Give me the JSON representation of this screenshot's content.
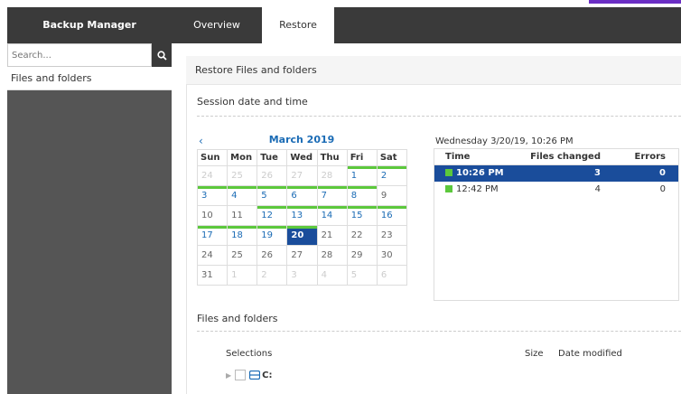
{
  "colors": {
    "accent": "#1a4d9b",
    "link": "#1a6bb5",
    "available": "#5cc83c",
    "dark": "#3a3a3a",
    "sidebar": "#555555"
  },
  "app": {
    "title": "Backup Manager"
  },
  "tabs": [
    {
      "label": "Overview"
    },
    {
      "label": "Restore"
    }
  ],
  "sidebar": {
    "search_placeholder": "Search...",
    "search_icon": "search-icon",
    "items": [
      {
        "label": "Files and folders"
      }
    ]
  },
  "main": {
    "panel_title": "Restore Files and folders",
    "session_section": "Session date and time",
    "files_section": "Files and folders"
  },
  "calendar": {
    "nav_prev": "‹",
    "month": "March 2019",
    "weekdays": [
      "Sun",
      "Mon",
      "Tue",
      "Wed",
      "Thu",
      "Fri",
      "Sat"
    ],
    "weeks": [
      [
        "24",
        "25",
        "26",
        "27",
        "28",
        "1",
        "2"
      ],
      [
        "3",
        "4",
        "5",
        "6",
        "7",
        "8",
        "9"
      ],
      [
        "10",
        "11",
        "12",
        "13",
        "14",
        "15",
        "16"
      ],
      [
        "17",
        "18",
        "19",
        "20",
        "21",
        "22",
        "23"
      ],
      [
        "24",
        "25",
        "26",
        "27",
        "28",
        "29",
        "30"
      ],
      [
        "31",
        "1",
        "2",
        "3",
        "4",
        "5",
        "6"
      ]
    ],
    "selected": "20"
  },
  "sessions": {
    "date_label": "Wednesday 3/20/19, 10:26 PM",
    "headers": [
      "Time",
      "Files changed",
      "Errors"
    ],
    "rows": [
      {
        "time": "10:26 PM",
        "files": "3",
        "errors": "0"
      },
      {
        "time": "12:42 PM",
        "files": "4",
        "errors": "0"
      }
    ]
  },
  "file_tree": {
    "headers": [
      "Selections",
      "Size",
      "Date modified"
    ],
    "items": [
      {
        "label": "C:"
      }
    ]
  }
}
